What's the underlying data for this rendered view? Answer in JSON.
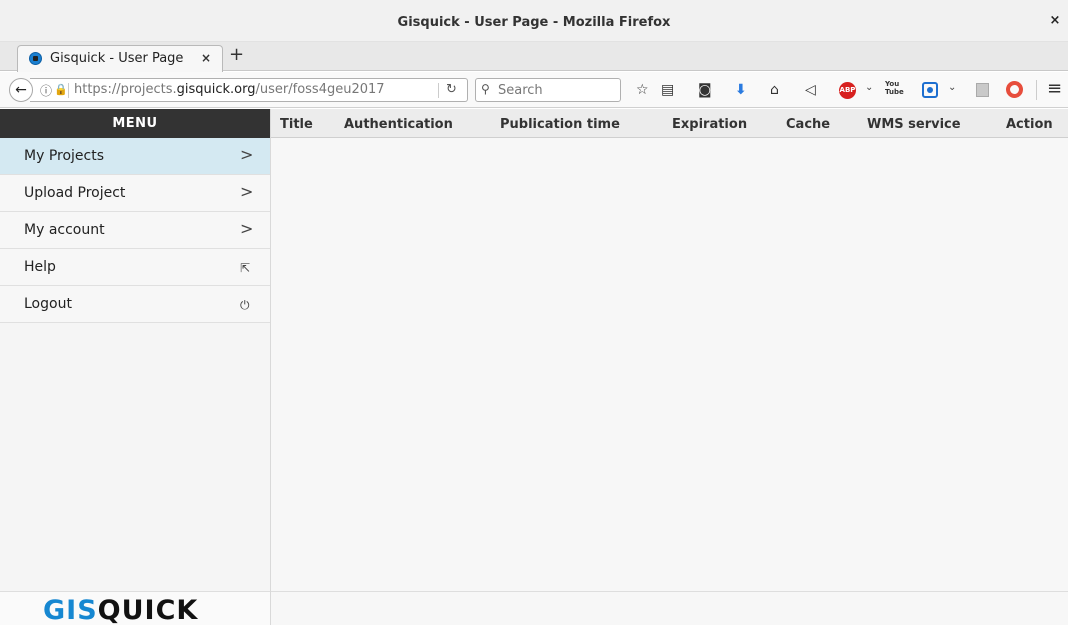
{
  "window": {
    "title": "Gisquick - User Page - Mozilla Firefox",
    "close_icon": "close-icon"
  },
  "tabs": [
    {
      "label": "Gisquick - User Page",
      "close": "×"
    }
  ],
  "new_tab": "+",
  "nav": {
    "url_prefix": "https://projects.",
    "url_domain": "gisquick.org",
    "url_path": "/user/foss4geu2017",
    "search_placeholder": "Search",
    "adblock_label": "ABP",
    "youtube_label": "You Tube"
  },
  "sidebar": {
    "header": "MENU",
    "items": [
      {
        "label": "My Projects",
        "icon": "chevron-right-icon",
        "glyph": ">",
        "active": true
      },
      {
        "label": "Upload Project",
        "icon": "chevron-right-icon",
        "glyph": ">",
        "active": false
      },
      {
        "label": "My account",
        "icon": "chevron-right-icon",
        "glyph": ">",
        "active": false
      },
      {
        "label": "Help",
        "icon": "external-link-icon",
        "glyph": "⇱",
        "active": false
      },
      {
        "label": "Logout",
        "icon": "power-icon",
        "glyph": "⏻",
        "active": false
      }
    ],
    "logo": {
      "part1": "GIS",
      "part2": "QUICK"
    }
  },
  "table": {
    "columns": [
      "Title",
      "Authentication",
      "Publication time",
      "Expiration",
      "Cache",
      "WMS service",
      "Action"
    ],
    "rows": []
  },
  "colors": {
    "menu_header": "#333333",
    "active_item": "#d4e9f2",
    "logo_accent": "#1687d1"
  }
}
